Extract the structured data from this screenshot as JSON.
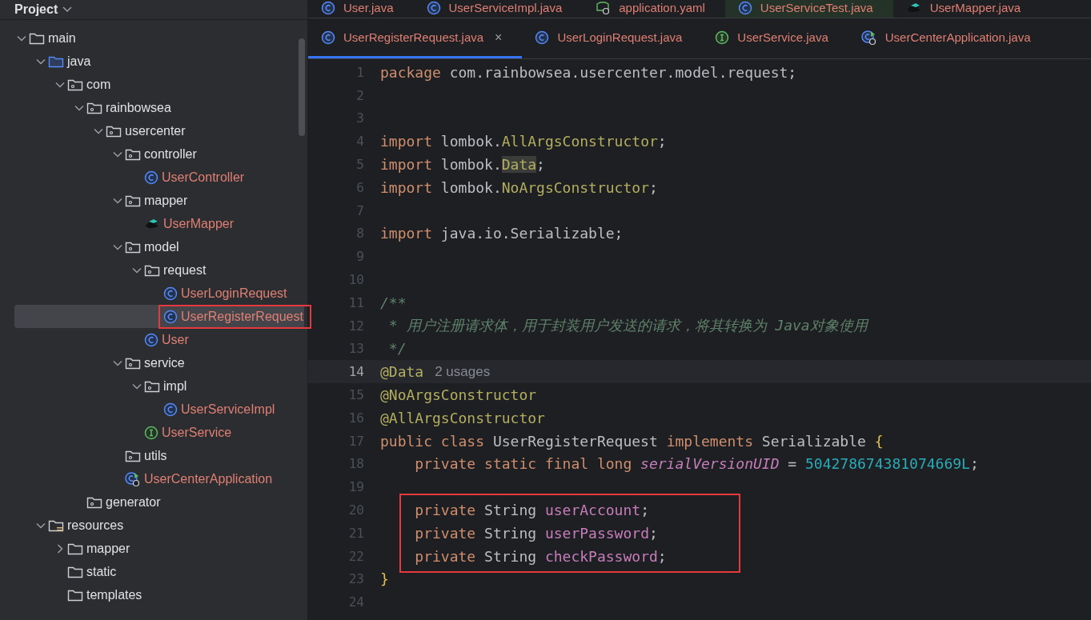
{
  "project_panel": {
    "title": "Project",
    "tree": [
      {
        "label": "main",
        "kind": "folder",
        "expanded": true,
        "selected": false,
        "marked": false,
        "children": [
          {
            "label": "java",
            "kind": "source-folder",
            "expanded": true,
            "selected": false,
            "marked": false,
            "children": [
              {
                "label": "com",
                "kind": "package",
                "expanded": true,
                "selected": false,
                "marked": false,
                "children": [
                  {
                    "label": "rainbowsea",
                    "kind": "package",
                    "expanded": true,
                    "selected": false,
                    "marked": false,
                    "children": [
                      {
                        "label": "usercenter",
                        "kind": "package",
                        "expanded": true,
                        "selected": false,
                        "marked": false,
                        "children": [
                          {
                            "label": "controller",
                            "kind": "package",
                            "expanded": true,
                            "selected": false,
                            "marked": false,
                            "children": [
                              {
                                "label": "UserController",
                                "kind": "class",
                                "selected": false,
                                "marked": false
                              }
                            ]
                          },
                          {
                            "label": "mapper",
                            "kind": "package",
                            "expanded": true,
                            "selected": false,
                            "marked": false,
                            "children": [
                              {
                                "label": "UserMapper",
                                "kind": "mapper",
                                "selected": false,
                                "marked": false
                              }
                            ]
                          },
                          {
                            "label": "model",
                            "kind": "package",
                            "expanded": true,
                            "selected": false,
                            "marked": false,
                            "children": [
                              {
                                "label": "request",
                                "kind": "package",
                                "expanded": true,
                                "selected": false,
                                "marked": false,
                                "children": [
                                  {
                                    "label": "UserLoginRequest",
                                    "kind": "class",
                                    "selected": false,
                                    "marked": false
                                  },
                                  {
                                    "label": "UserRegisterRequest",
                                    "kind": "class",
                                    "selected": true,
                                    "marked": true
                                  }
                                ]
                              },
                              {
                                "label": "User",
                                "kind": "class",
                                "selected": false,
                                "marked": false
                              }
                            ]
                          },
                          {
                            "label": "service",
                            "kind": "package",
                            "expanded": true,
                            "selected": false,
                            "marked": false,
                            "children": [
                              {
                                "label": "impl",
                                "kind": "package",
                                "expanded": true,
                                "selected": false,
                                "marked": false,
                                "children": [
                                  {
                                    "label": "UserServiceImpl",
                                    "kind": "class",
                                    "selected": false,
                                    "marked": false
                                  }
                                ]
                              },
                              {
                                "label": "UserService",
                                "kind": "interface",
                                "selected": false,
                                "marked": false
                              }
                            ]
                          },
                          {
                            "label": "utils",
                            "kind": "package",
                            "selected": false,
                            "marked": false
                          },
                          {
                            "label": "UserCenterApplication",
                            "kind": "app",
                            "selected": false,
                            "marked": false
                          }
                        ]
                      }
                    ]
                  },
                  {
                    "label": "generator",
                    "kind": "package",
                    "selected": false,
                    "marked": false
                  }
                ]
              }
            ]
          },
          {
            "label": "resources",
            "kind": "resources-folder",
            "expanded": true,
            "selected": false,
            "marked": false,
            "children": [
              {
                "label": "mapper",
                "kind": "folder",
                "expanded": false,
                "selected": false,
                "marked": false
              },
              {
                "label": "static",
                "kind": "folder",
                "selected": false,
                "marked": false
              },
              {
                "label": "templates",
                "kind": "folder",
                "selected": false,
                "marked": false
              }
            ]
          }
        ]
      }
    ]
  },
  "editor_tabs": [
    [
      {
        "label": "User.java",
        "kind": "class",
        "selected": false,
        "tinted": false
      },
      {
        "label": "UserServiceImpl.java",
        "kind": "class",
        "selected": false,
        "tinted": false
      },
      {
        "label": "application.yaml",
        "kind": "yaml",
        "selected": false,
        "tinted": false
      },
      {
        "label": "UserServiceTest.java",
        "kind": "class",
        "selected": false,
        "tinted": true
      },
      {
        "label": "UserMapper.java",
        "kind": "mapper",
        "selected": false,
        "tinted": false
      }
    ],
    [
      {
        "label": "UserRegisterRequest.java",
        "kind": "class",
        "selected": true,
        "tinted": false,
        "close": "×"
      },
      {
        "label": "UserLoginRequest.java",
        "kind": "class",
        "selected": false,
        "tinted": false
      },
      {
        "label": "UserService.java",
        "kind": "interface",
        "selected": false,
        "tinted": false
      },
      {
        "label": "UserCenterApplication.java",
        "kind": "app",
        "selected": false,
        "tinted": false
      }
    ]
  ],
  "code": [
    {
      "number": "1",
      "current": false,
      "marked": false,
      "tokens": [
        {
          "kind": "keyword",
          "text": "package"
        },
        {
          "kind": "plain",
          "text": " com.rainbowsea.usercenter.model.request;"
        }
      ]
    },
    {
      "number": "2",
      "current": false,
      "marked": false
    },
    {
      "number": "3",
      "current": false,
      "marked": false
    },
    {
      "number": "4",
      "current": false,
      "marked": false,
      "tokens": [
        {
          "kind": "keyword",
          "text": "import"
        },
        {
          "kind": "plain",
          "text": " lombok."
        },
        {
          "kind": "type",
          "text": "AllArgsConstructor"
        },
        {
          "kind": "plain",
          "text": ";"
        }
      ]
    },
    {
      "number": "5",
      "current": false,
      "marked": false,
      "tokens": [
        {
          "kind": "keyword",
          "text": "import"
        },
        {
          "kind": "plain",
          "text": " lombok."
        },
        {
          "kind": "type-hl",
          "text": "Data"
        },
        {
          "kind": "plain",
          "text": ";"
        }
      ]
    },
    {
      "number": "6",
      "current": false,
      "marked": false,
      "tokens": [
        {
          "kind": "keyword",
          "text": "import"
        },
        {
          "kind": "plain",
          "text": " lombok."
        },
        {
          "kind": "type",
          "text": "NoArgsConstructor"
        },
        {
          "kind": "plain",
          "text": ";"
        }
      ]
    },
    {
      "number": "7",
      "current": false,
      "marked": false
    },
    {
      "number": "8",
      "current": false,
      "marked": false,
      "tokens": [
        {
          "kind": "keyword",
          "text": "import"
        },
        {
          "kind": "plain",
          "text": " java.io.Serializable;"
        }
      ]
    },
    {
      "number": "9",
      "current": false,
      "marked": false
    },
    {
      "number": "10",
      "current": false,
      "marked": false
    },
    {
      "number": "11",
      "current": false,
      "marked": false,
      "tokens": [
        {
          "kind": "doc",
          "text": "/**"
        }
      ]
    },
    {
      "number": "12",
      "current": false,
      "marked": false,
      "tokens": [
        {
          "kind": "doc",
          "text": " * 用户注册请求体，用于封装用户发送的请求，将其转换为 Java对象使用"
        }
      ]
    },
    {
      "number": "13",
      "current": false,
      "marked": false,
      "tokens": [
        {
          "kind": "doc",
          "text": " */"
        }
      ]
    },
    {
      "number": "14",
      "current": true,
      "marked": false,
      "tokens": [
        {
          "kind": "type",
          "text": "@Data"
        },
        {
          "kind": "hint",
          "text": "2 usages"
        }
      ]
    },
    {
      "number": "15",
      "current": false,
      "marked": false,
      "tokens": [
        {
          "kind": "type",
          "text": "@NoArgsConstructor"
        }
      ]
    },
    {
      "number": "16",
      "current": false,
      "marked": false,
      "tokens": [
        {
          "kind": "type",
          "text": "@AllArgsConstructor"
        }
      ]
    },
    {
      "number": "17",
      "current": false,
      "marked": false,
      "tokens": [
        {
          "kind": "keyword",
          "text": "public class"
        },
        {
          "kind": "plain",
          "text": " UserRegisterRequest "
        },
        {
          "kind": "keyword",
          "text": "implements"
        },
        {
          "kind": "plain",
          "text": " Serializable "
        },
        {
          "kind": "brace",
          "text": "{"
        }
      ]
    },
    {
      "number": "18",
      "current": false,
      "marked": false,
      "tokens": [
        {
          "kind": "keyword",
          "text": "    private static final long "
        },
        {
          "kind": "static",
          "text": "serialVersionUID"
        },
        {
          "kind": "plain",
          "text": " = "
        },
        {
          "kind": "number",
          "text": "504278674381074669L"
        },
        {
          "kind": "plain",
          "text": ";"
        }
      ]
    },
    {
      "number": "19",
      "current": false,
      "marked": false
    },
    {
      "number": "20",
      "current": false,
      "marked": true,
      "tokens": [
        {
          "kind": "keyword",
          "text": "    private"
        },
        {
          "kind": "plain",
          "text": " String "
        },
        {
          "kind": "field",
          "text": "userAccount"
        },
        {
          "kind": "plain",
          "text": ";"
        }
      ]
    },
    {
      "number": "21",
      "current": false,
      "marked": true,
      "tokens": [
        {
          "kind": "keyword",
          "text": "    private"
        },
        {
          "kind": "plain",
          "text": " String "
        },
        {
          "kind": "field",
          "text": "userPassword"
        },
        {
          "kind": "plain",
          "text": ";"
        }
      ]
    },
    {
      "number": "22",
      "current": false,
      "marked": true,
      "tokens": [
        {
          "kind": "keyword",
          "text": "    private"
        },
        {
          "kind": "plain",
          "text": " String "
        },
        {
          "kind": "field",
          "text": "checkPassword"
        },
        {
          "kind": "plain",
          "text": ";"
        }
      ]
    },
    {
      "number": "23",
      "current": false,
      "marked": false,
      "tokens": [
        {
          "kind": "brace",
          "text": "}"
        }
      ]
    },
    {
      "number": "24",
      "current": false,
      "marked": false
    }
  ]
}
